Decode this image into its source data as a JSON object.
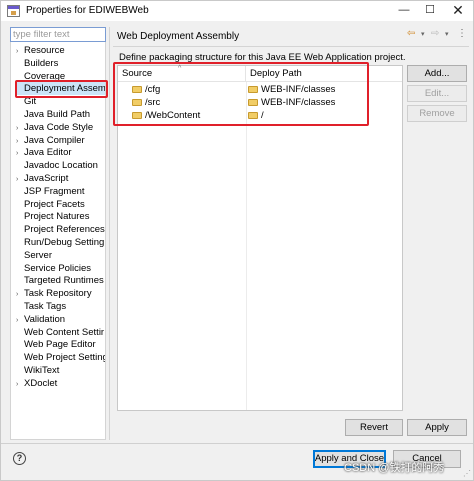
{
  "window": {
    "title": "Properties for EDIWEBWeb",
    "min_glyph": "—",
    "max_glyph": "☐",
    "close_glyph": "✕"
  },
  "filter": {
    "placeholder": "type filter text"
  },
  "sidebar": {
    "items": [
      {
        "label": "Resource",
        "arrow": "›"
      },
      {
        "label": "Builders",
        "arrow": ""
      },
      {
        "label": "Coverage",
        "arrow": ""
      },
      {
        "label": "Deployment Assem",
        "arrow": "",
        "selected": true
      },
      {
        "label": "Git",
        "arrow": ""
      },
      {
        "label": "Java Build Path",
        "arrow": ""
      },
      {
        "label": "Java Code Style",
        "arrow": "›"
      },
      {
        "label": "Java Compiler",
        "arrow": "›"
      },
      {
        "label": "Java Editor",
        "arrow": "›"
      },
      {
        "label": "Javadoc Location",
        "arrow": ""
      },
      {
        "label": "JavaScript",
        "arrow": "›"
      },
      {
        "label": "JSP Fragment",
        "arrow": ""
      },
      {
        "label": "Project Facets",
        "arrow": ""
      },
      {
        "label": "Project Natures",
        "arrow": ""
      },
      {
        "label": "Project References",
        "arrow": ""
      },
      {
        "label": "Run/Debug Setting",
        "arrow": ""
      },
      {
        "label": "Server",
        "arrow": ""
      },
      {
        "label": "Service Policies",
        "arrow": ""
      },
      {
        "label": "Targeted Runtimes",
        "arrow": ""
      },
      {
        "label": "Task Repository",
        "arrow": "›"
      },
      {
        "label": "Task Tags",
        "arrow": ""
      },
      {
        "label": "Validation",
        "arrow": "›"
      },
      {
        "label": "Web Content Settir",
        "arrow": ""
      },
      {
        "label": "Web Page Editor",
        "arrow": ""
      },
      {
        "label": "Web Project Setting",
        "arrow": ""
      },
      {
        "label": "WikiText",
        "arrow": ""
      },
      {
        "label": "XDoclet",
        "arrow": "›"
      }
    ]
  },
  "pane": {
    "title": "Web Deployment Assembly",
    "description": "Define packaging structure for this Java EE Web Application project.",
    "nav": {
      "back": "⇦",
      "forward": "⇨",
      "dropdown": "▾",
      "menu": "⋮"
    }
  },
  "table": {
    "headers": {
      "source": "Source",
      "deploy_path": "Deploy Path",
      "sort_glyph": "^"
    },
    "rows": [
      {
        "source": "/cfg",
        "deploy_path": "WEB-INF/classes"
      },
      {
        "source": "/src",
        "deploy_path": "WEB-INF/classes"
      },
      {
        "source": "/WebContent",
        "deploy_path": "/"
      }
    ]
  },
  "side_buttons": {
    "add": "Add...",
    "edit": "Edit...",
    "remove": "Remove"
  },
  "footer": {
    "revert": "Revert",
    "apply": "Apply",
    "apply_and_close": "Apply and Close",
    "cancel": "Cancel",
    "help_glyph": "?"
  },
  "watermark": "CSDN @铁打的阿秀",
  "colors": {
    "highlight": "#e0202a",
    "selection": "#cce4f7",
    "folder": "#f1cd66"
  }
}
